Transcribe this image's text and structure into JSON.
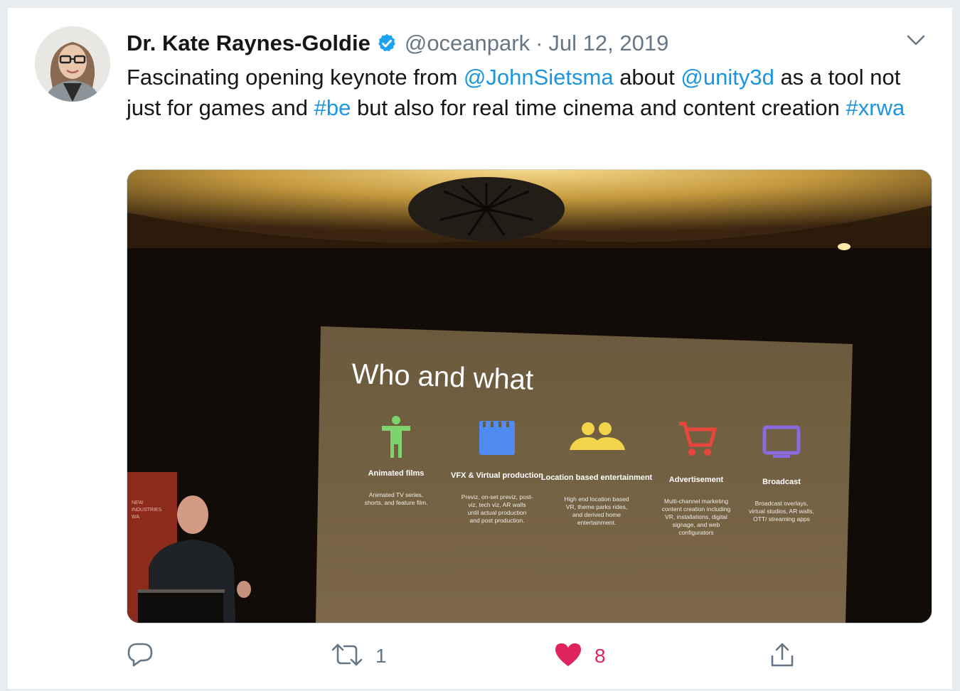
{
  "author": {
    "name": "Dr. Kate Raynes-Goldie",
    "handle": "@oceanpark",
    "separator": "·",
    "date": "Jul 12, 2019",
    "verified": true
  },
  "tweet": {
    "segments": [
      {
        "text": "Fascinating opening keynote from ",
        "link": false
      },
      {
        "text": "@JohnSietsma",
        "link": true
      },
      {
        "text": " about ",
        "link": false
      },
      {
        "text": "@unity3d",
        "link": true
      },
      {
        "text": " as a tool not just for games and ",
        "link": false
      },
      {
        "text": "#be",
        "link": true
      },
      {
        "text": " but also for real time cinema and content creation ",
        "link": false
      },
      {
        "text": "#xrwa",
        "link": true
      }
    ]
  },
  "media": {
    "slide": {
      "title": "Who and what",
      "items": [
        {
          "icon": "person-icon",
          "color": "#7ed36f",
          "title": "Animated films",
          "desc": [
            "Animated TV series,",
            "shorts, and feature film."
          ]
        },
        {
          "icon": "clapperboard-icon",
          "color": "#4f8bf0",
          "title": "VFX & Virtual production",
          "desc": [
            "Previz, on-set previz, post-",
            "viz, tech viz, AR walls",
            "until actual production",
            "and post production."
          ]
        },
        {
          "icon": "people-icon",
          "color": "#f2d44a",
          "title": "Location based entertainment",
          "desc": [
            "High end location based",
            "VR, theme parks rides,",
            "and derived home",
            "entertainment."
          ]
        },
        {
          "icon": "cart-icon",
          "color": "#e6473a",
          "title": "Advertisement",
          "desc": [
            "Multi-channel marketing",
            "content creation including",
            "VR, installations, digital",
            "signage, and web",
            "configurators"
          ]
        },
        {
          "icon": "tv-icon",
          "color": "#8a6ae0",
          "title": "Broadcast",
          "desc": [
            "Broadcast overlays,",
            "virtual studios, AR walls,",
            "OTT/ streaming apps"
          ]
        }
      ]
    }
  },
  "actions": {
    "reply": {
      "icon": "reply-icon",
      "count": ""
    },
    "retweet": {
      "icon": "retweet-icon",
      "count": "1"
    },
    "like": {
      "icon": "heart-icon",
      "count": "8",
      "color": "#e0245e"
    },
    "share": {
      "icon": "share-icon",
      "count": ""
    }
  },
  "colors": {
    "link": "#1b95e0",
    "verified": "#1da1f2",
    "secondary_text": "#657786"
  }
}
